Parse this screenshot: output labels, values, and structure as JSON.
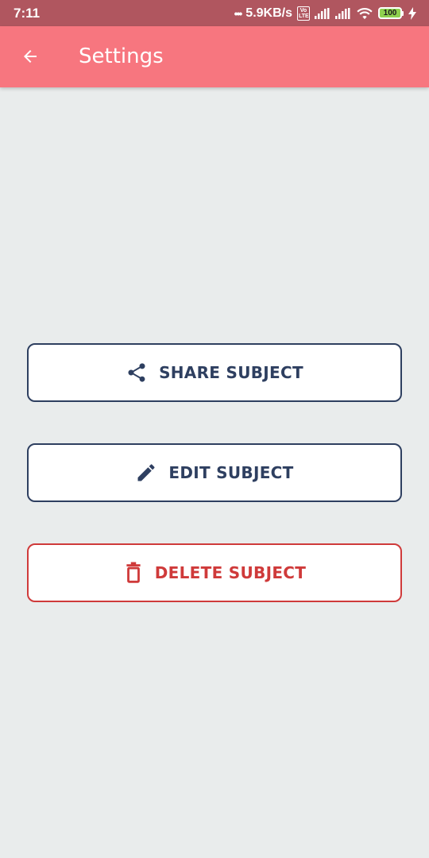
{
  "status_bar": {
    "time": "7:11",
    "dots": "•••",
    "net_speed": "5.9KB/s",
    "volte": "Vo LTE",
    "battery": "100"
  },
  "app_bar": {
    "back_icon": "arrow-left-icon",
    "title": "Settings"
  },
  "actions": {
    "share": {
      "label": "SHARE SUBJECT",
      "icon": "share-icon"
    },
    "edit": {
      "label": "EDIT SUBJECT",
      "icon": "pencil-icon"
    },
    "delete": {
      "label": "DELETE SUBJECT",
      "icon": "trash-icon"
    }
  },
  "colors": {
    "app_bar": "#f7767f",
    "status_bar": "#b0565f",
    "background": "#e9ecec",
    "primary": "#2e3f60",
    "danger": "#cf3a3a"
  }
}
